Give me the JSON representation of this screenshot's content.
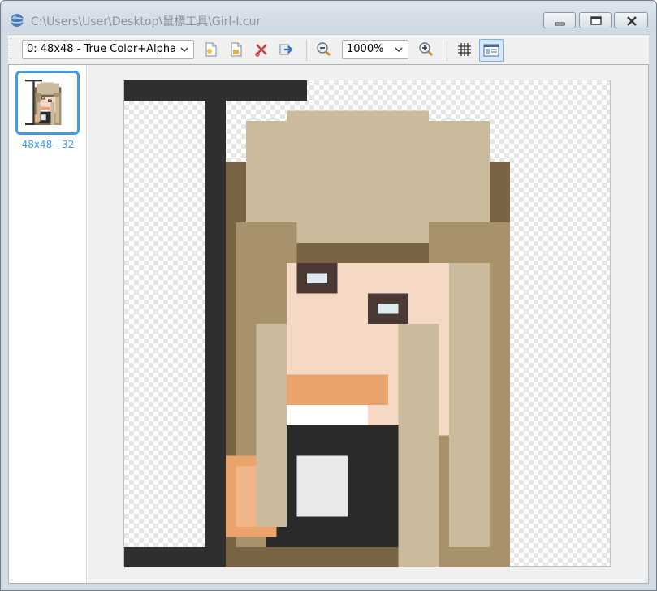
{
  "window": {
    "title": "C:\\Users\\User\\Desktop\\鼠標工具\\Girl-I.cur",
    "icon": "app-globe-icon",
    "controls": [
      "minimize-icon",
      "maximize-icon",
      "close-icon"
    ]
  },
  "toolbar": {
    "image_select": {
      "value": "0: 48x48 - True Color+Alpha"
    },
    "zoom_select": {
      "value": "1000%"
    },
    "icons": [
      "new-image-icon",
      "import-image-icon",
      "delete-image-icon",
      "export-image-icon",
      "zoom-out-icon",
      "zoom-in-icon",
      "grid-icon",
      "preview-pane-icon"
    ]
  },
  "sidebar": {
    "thumbnails": [
      {
        "label": "48x48 - 32",
        "selected": true
      }
    ]
  },
  "colors": {
    "accent": "#3d9bf2",
    "hair_light": "#c9bb9b",
    "hair_mid": "#a8926c",
    "hair_dark": "#7a6446",
    "skin": "#f5d9c4",
    "skin_shadow": "#e9a36b",
    "cursor_bar": "#2f2f2f"
  }
}
